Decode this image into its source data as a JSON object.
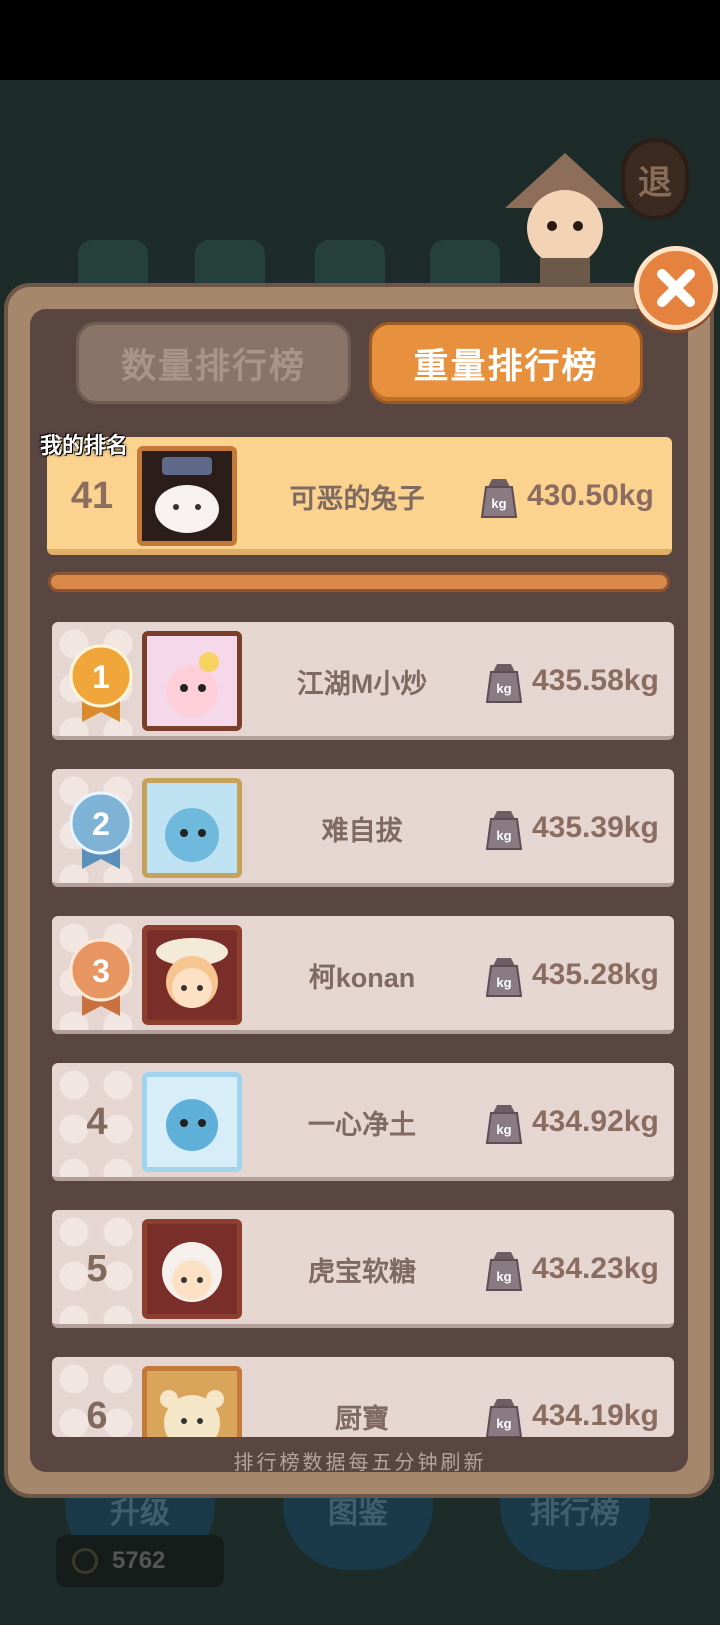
{
  "header": {
    "exit_label": "退"
  },
  "tabs": [
    {
      "label": "数量排行榜",
      "active": false
    },
    {
      "label": "重量排行榜",
      "active": true
    }
  ],
  "my_rank": {
    "label": "我的排名",
    "rank": "41",
    "name": "可恶的兔子",
    "weight": "430.50kg"
  },
  "leaderboard": [
    {
      "rank": "1",
      "name": "江湖M小炒",
      "weight": "435.58kg",
      "medal": "gold"
    },
    {
      "rank": "2",
      "name": "难自拔",
      "weight": "435.39kg",
      "medal": "silver"
    },
    {
      "rank": "3",
      "name": "柯konan",
      "weight": "435.28kg",
      "medal": "bronze"
    },
    {
      "rank": "4",
      "name": "一心净土",
      "weight": "434.92kg"
    },
    {
      "rank": "5",
      "name": "虎宝软糖",
      "weight": "434.23kg"
    },
    {
      "rank": "6",
      "name": "厨寶",
      "weight": "434.19kg"
    }
  ],
  "footer": "排行榜数据每五分钟刷新",
  "bottom_nav": [
    {
      "label": "升级"
    },
    {
      "label": "图鉴"
    },
    {
      "label": "排行榜"
    }
  ],
  "coins": "5762",
  "colors": {
    "accent": "#e7913f",
    "panel": "#5a4641",
    "row": "#e6d6d2",
    "highlight": "#fbd38e",
    "gold": "#f0a63a",
    "silver": "#7eb3d6",
    "bronze": "#e79561"
  }
}
